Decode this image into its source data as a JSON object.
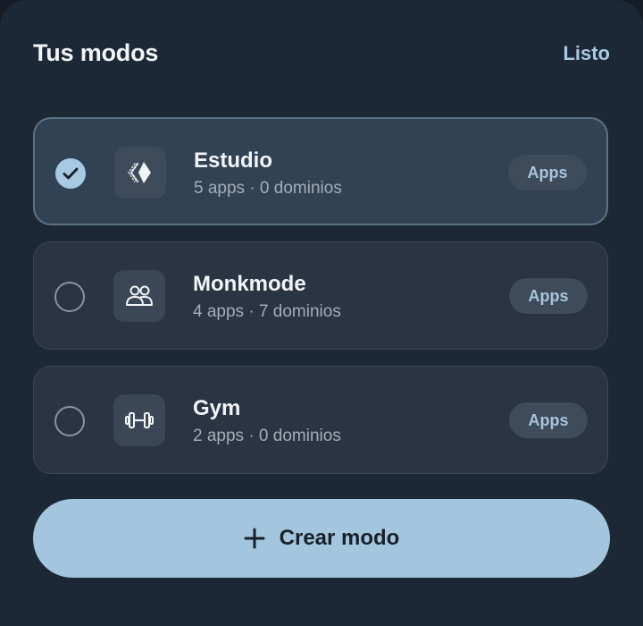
{
  "header": {
    "title": "Tus modos",
    "done_label": "Listo"
  },
  "modes": [
    {
      "name": "Estudio",
      "meta": "5 apps · 0 dominios",
      "apps_label": "Apps",
      "selected": true,
      "icon": "cards-icon"
    },
    {
      "name": "Monkmode",
      "meta": "4 apps · 7 dominios",
      "apps_label": "Apps",
      "selected": false,
      "icon": "people-icon"
    },
    {
      "name": "Gym",
      "meta": "2 apps · 0 dominios",
      "apps_label": "Apps",
      "selected": false,
      "icon": "dumbbell-icon"
    }
  ],
  "create_button": {
    "label": "Crear modo",
    "icon": "plus-icon"
  },
  "colors": {
    "sheet_bg": "#1d2836",
    "card_bg": "#2a3443",
    "card_selected_bg": "#314255",
    "accent": "#a3c6de",
    "text_primary": "#f2f5f8",
    "text_secondary": "#a3adb8"
  }
}
